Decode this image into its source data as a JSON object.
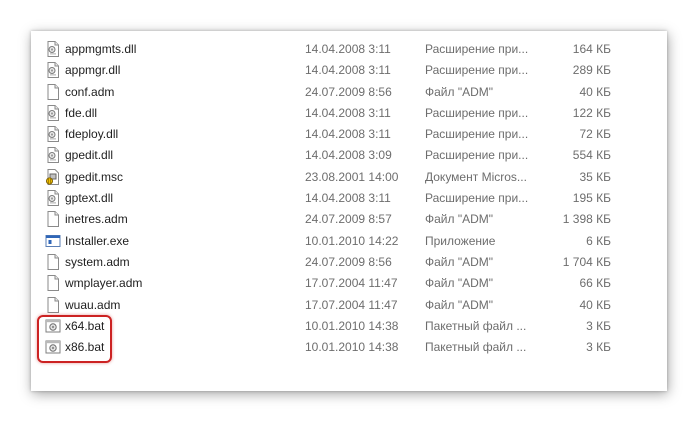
{
  "files": [
    {
      "name": "appmgmts.dll",
      "date": "14.04.2008 3:11",
      "type": "Расширение при...",
      "size": "164 КБ",
      "icon": "dll-icon"
    },
    {
      "name": "appmgr.dll",
      "date": "14.04.2008 3:11",
      "type": "Расширение при...",
      "size": "289 КБ",
      "icon": "dll-icon"
    },
    {
      "name": "conf.adm",
      "date": "24.07.2009 8:56",
      "type": "Файл \"ADM\"",
      "size": "40 КБ",
      "icon": "document-icon"
    },
    {
      "name": "fde.dll",
      "date": "14.04.2008 3:11",
      "type": "Расширение при...",
      "size": "122 КБ",
      "icon": "dll-icon"
    },
    {
      "name": "fdeploy.dll",
      "date": "14.04.2008 3:11",
      "type": "Расширение при...",
      "size": "72 КБ",
      "icon": "dll-icon"
    },
    {
      "name": "gpedit.dll",
      "date": "14.04.2008 3:09",
      "type": "Расширение при...",
      "size": "554 КБ",
      "icon": "dll-icon"
    },
    {
      "name": "gpedit.msc",
      "date": "23.08.2001 14:00",
      "type": "Документ Micros...",
      "size": "35 КБ",
      "icon": "msc-icon"
    },
    {
      "name": "gptext.dll",
      "date": "14.04.2008 3:11",
      "type": "Расширение при...",
      "size": "195 КБ",
      "icon": "dll-icon"
    },
    {
      "name": "inetres.adm",
      "date": "24.07.2009 8:57",
      "type": "Файл \"ADM\"",
      "size": "1 398 КБ",
      "icon": "document-icon"
    },
    {
      "name": "Installer.exe",
      "date": "10.01.2010 14:22",
      "type": "Приложение",
      "size": "6 КБ",
      "icon": "exe-icon"
    },
    {
      "name": "system.adm",
      "date": "24.07.2009 8:56",
      "type": "Файл \"ADM\"",
      "size": "1 704 КБ",
      "icon": "document-icon"
    },
    {
      "name": "wmplayer.adm",
      "date": "17.07.2004 11:47",
      "type": "Файл \"ADM\"",
      "size": "66 КБ",
      "icon": "document-icon"
    },
    {
      "name": "wuau.adm",
      "date": "17.07.2004 11:47",
      "type": "Файл \"ADM\"",
      "size": "40 КБ",
      "icon": "document-icon"
    },
    {
      "name": "x64.bat",
      "date": "10.01.2010 14:38",
      "type": "Пакетный файл ...",
      "size": "3 КБ",
      "icon": "bat-icon"
    },
    {
      "name": "x86.bat",
      "date": "10.01.2010 14:38",
      "type": "Пакетный файл ...",
      "size": "3 КБ",
      "icon": "bat-icon"
    }
  ],
  "colors": {
    "highlight_border": "#cc2222",
    "secondary_text": "#6d6d6d",
    "primary_text": "#1e1e1e"
  }
}
